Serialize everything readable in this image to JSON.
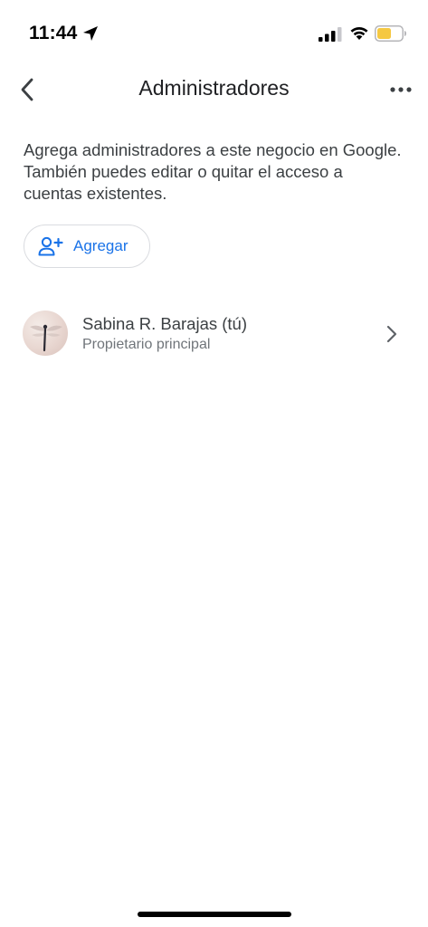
{
  "status_bar": {
    "time": "11:44",
    "location_icon": "location-arrow-icon",
    "signal_icon": "cellular-signal-icon",
    "wifi_icon": "wifi-icon",
    "battery_icon": "battery-icon",
    "battery_color": "#f5c842"
  },
  "header": {
    "back_icon": "chevron-left-icon",
    "title": "Administradores",
    "more_icon": "more-horizontal-icon"
  },
  "main": {
    "description": "Agrega administradores a este negocio en Google. También puedes editar o quitar el acceso a cuentas existentes.",
    "add_button": {
      "icon": "person-add-icon",
      "label": "Agregar",
      "color": "#1a73e8"
    },
    "users": [
      {
        "avatar": "avatar-dragonfly",
        "name": "Sabina R. Barajas (tú)",
        "role": "Propietario principal",
        "chevron_icon": "chevron-right-icon"
      }
    ]
  }
}
